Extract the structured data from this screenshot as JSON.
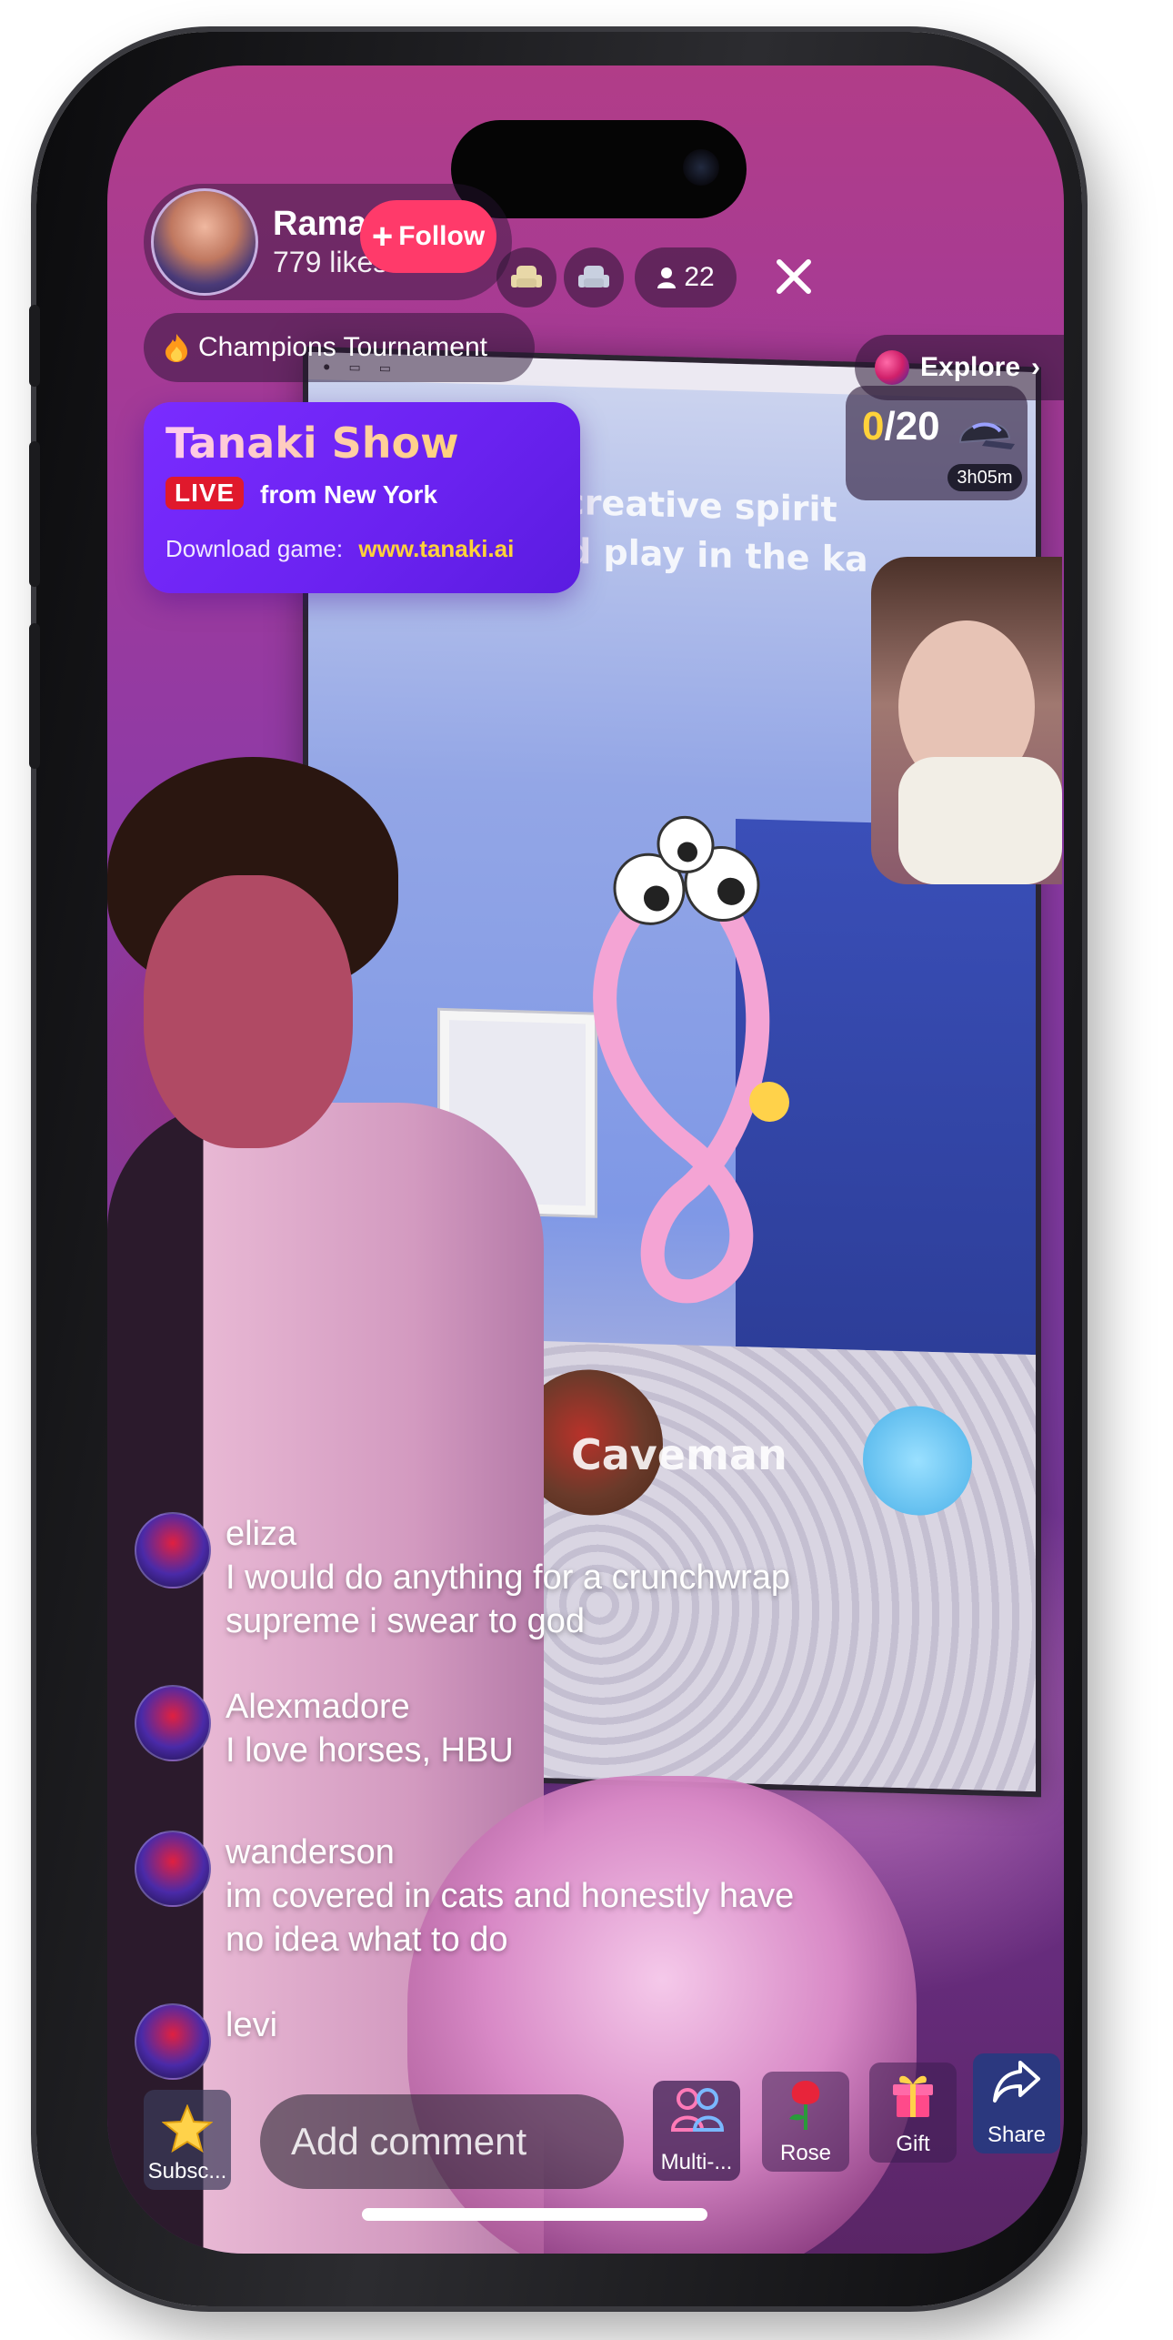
{
  "host": {
    "name": "Rama",
    "likes": "779 likes",
    "follow_label": "Follow"
  },
  "header": {
    "viewer_count": "22",
    "tournament_label": "Champions Tournament",
    "explore_label": "Explore"
  },
  "show": {
    "title": "Tanaki Show",
    "live_badge": "LIVE",
    "location": "from New York",
    "download_label": "Download game:",
    "download_url": "www.tanaki.ai"
  },
  "score": {
    "current": "0",
    "total": "/20",
    "timer": "3h05m"
  },
  "game": {
    "prompt": "Let your creative spirit dance and play in the ka",
    "word": "Caveman"
  },
  "chat": [
    {
      "user": "eliza",
      "message": "I would do anything for a crunchwrap supreme i swear to god"
    },
    {
      "user": "Alexmadore",
      "message": "I love horses, HBU"
    },
    {
      "user": "wanderson",
      "message": "im covered in cats and honestly have no idea what to do"
    },
    {
      "user": "levi",
      "message": ""
    }
  ],
  "bottom_bar": {
    "subscribe_label": "Subsc...",
    "comment_placeholder": "Add comment",
    "multi_label": "Multi-...",
    "rose_label": "Rose",
    "gift_label": "Gift",
    "share_label": "Share"
  },
  "colors": {
    "follow": "#ff3a6a",
    "live": "#e0192c",
    "show_card": "#7a2cff",
    "score_highlight": "#ffd23a",
    "url": "#ffd23a"
  }
}
